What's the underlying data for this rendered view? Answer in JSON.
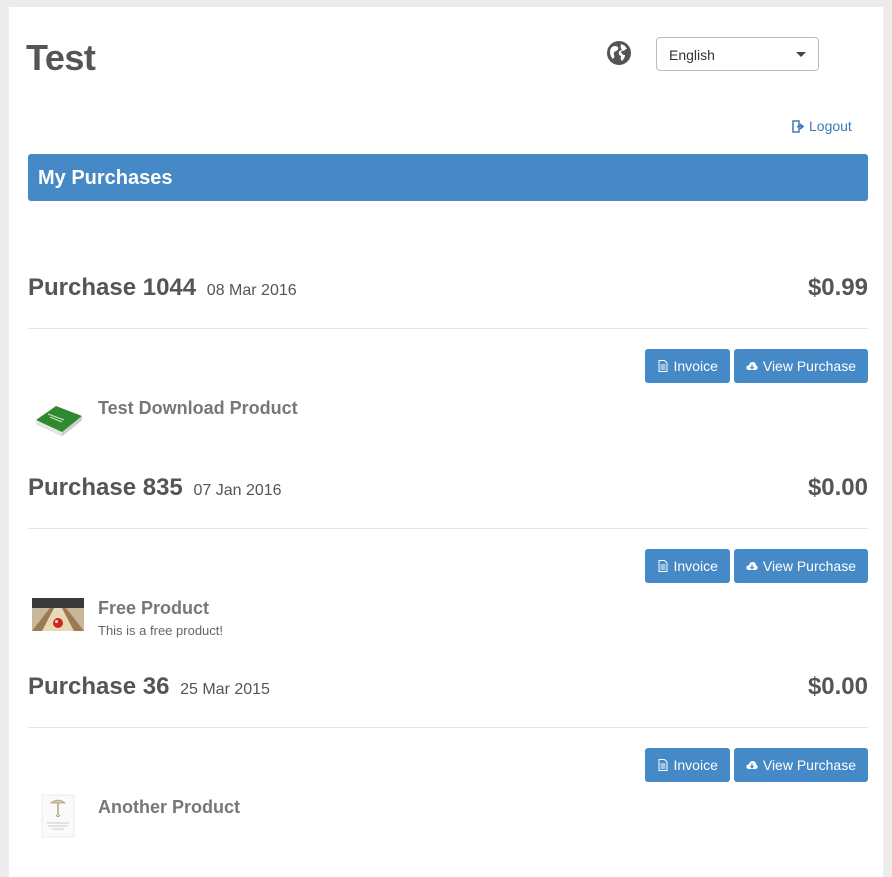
{
  "header": {
    "site_title": "Test",
    "language_selected": "English",
    "logout_label": "Logout"
  },
  "banner": {
    "title": "My Purchases"
  },
  "actions": {
    "invoice_label": "Invoice",
    "view_label": "View Purchase"
  },
  "purchases": [
    {
      "title": "Purchase 1044",
      "date": "08 Mar 2016",
      "total": "$0.99",
      "product": {
        "name": "Test Download Product",
        "description": "",
        "thumb_icon": "green-book-thumbnail"
      }
    },
    {
      "title": "Purchase 835",
      "date": "07 Jan 2016",
      "total": "$0.00",
      "product": {
        "name": "Free Product",
        "description": "This is a free product!",
        "thumb_icon": "bowling-lane-thumbnail"
      }
    },
    {
      "title": "Purchase 36",
      "date": "25 Mar 2015",
      "total": "$0.00",
      "product": {
        "name": "Another Product",
        "description": "",
        "thumb_icon": "booklet-thumbnail"
      }
    }
  ],
  "colors": {
    "primary": "#4589c7",
    "link": "#3d7ab8",
    "text": "#555555",
    "background": "#ececec"
  }
}
